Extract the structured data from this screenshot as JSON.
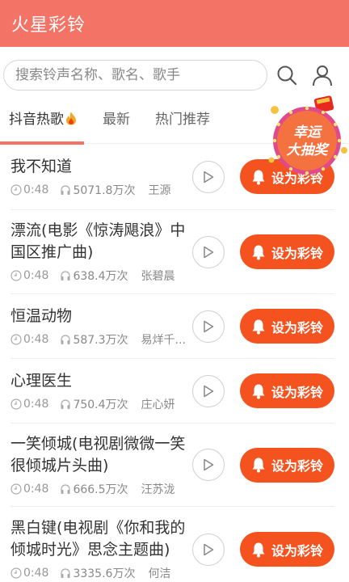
{
  "app": {
    "title": "火星彩铃"
  },
  "search": {
    "placeholder": "搜索铃声名称、歌名、歌手"
  },
  "tabs": [
    {
      "label": "抖音热歌"
    },
    {
      "label": "最新"
    },
    {
      "label": "热门推荐"
    }
  ],
  "promo": {
    "line1": "幸运",
    "line2": "大抽奖"
  },
  "set_button_label": "设为彩铃",
  "songs": [
    {
      "title": "我不知道",
      "duration": "0:48",
      "plays": "5071.8万次",
      "artist": "王源"
    },
    {
      "title": "漂流(电影《惊涛飓浪》中国区推广曲)",
      "duration": "0:48",
      "plays": "638.4万次",
      "artist": "张碧晨"
    },
    {
      "title": "恒温动物",
      "duration": "0:48",
      "plays": "587.3万次",
      "artist": "易烊千..."
    },
    {
      "title": "心理医生",
      "duration": "0:48",
      "plays": "750.4万次",
      "artist": "庄心妍"
    },
    {
      "title": "一笑倾城(电视剧微微一笑很倾城片头曲)",
      "duration": "0:48",
      "plays": "666.5万次",
      "artist": "汪苏泷"
    },
    {
      "title": "黑白键(电视剧《你和我的倾城时光》思念主题曲)",
      "duration": "0:48",
      "plays": "3335.6万次",
      "artist": "何洁"
    }
  ],
  "colors": {
    "header": "#f47367",
    "button": "#f4531f",
    "tab_underline": "#f47367"
  }
}
